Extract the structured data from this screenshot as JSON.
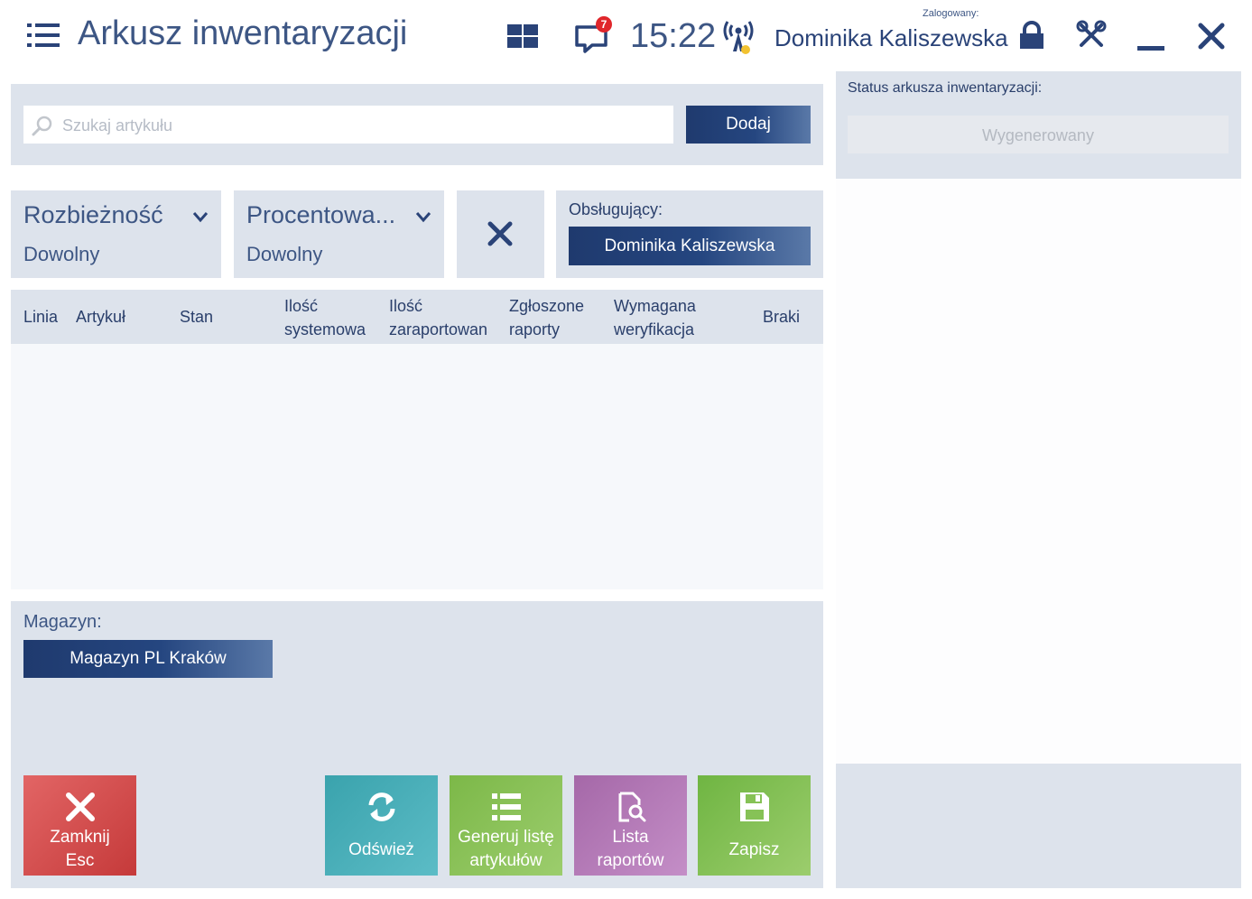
{
  "header": {
    "title": "Arkusz inwentaryzacji",
    "notification_count": "7",
    "time": "15:22",
    "logged_label": "Zalogowany:",
    "user_name": "Dominika Kaliszewska"
  },
  "search": {
    "placeholder": "Szukaj artykułu",
    "add_label": "Dodaj"
  },
  "status": {
    "label": "Status arkusza inwentaryzacji:",
    "value": "Wygenerowany"
  },
  "filters": [
    {
      "title": "Rozbieżność",
      "value": "Dowolny"
    },
    {
      "title": "Procentowa...",
      "value": "Dowolny"
    }
  ],
  "operator": {
    "label": "Obsługujący:",
    "value": "Dominika Kaliszewska"
  },
  "table": {
    "columns": [
      {
        "line1": "Linia",
        "line2": ""
      },
      {
        "line1": "Artykuł",
        "line2": ""
      },
      {
        "line1": "Stan",
        "line2": ""
      },
      {
        "line1": "Ilość",
        "line2": "systemowa"
      },
      {
        "line1": "Ilość",
        "line2": "zaraportowana"
      },
      {
        "line1": "Zgłoszone",
        "line2": "raporty"
      },
      {
        "line1": "Wymagana",
        "line2": "weryfikacja"
      },
      {
        "line1": "Braki",
        "line2": ""
      }
    ],
    "rows": []
  },
  "warehouse": {
    "label": "Magazyn:",
    "value": "Magazyn PL Kraków"
  },
  "actions": {
    "close": {
      "line1": "Zamknij",
      "line2": "Esc"
    },
    "refresh": {
      "line1": "Odśwież"
    },
    "generate": {
      "line1": "Generuj listę",
      "line2": "artykułów"
    },
    "reports": {
      "line1": "Lista",
      "line2": "raportów"
    },
    "save": {
      "line1": "Zapisz"
    }
  },
  "colors": {
    "accent": "#254680",
    "panel": "#dde3ec",
    "close_tile": "#d14d4d",
    "refresh_tile": "#4aafb9",
    "generate_tile": "#8cc25a",
    "reports_tile": "#b57bb8",
    "save_tile": "#86c256",
    "badge": "#e0262b",
    "signal_dot": "#f2c230"
  }
}
